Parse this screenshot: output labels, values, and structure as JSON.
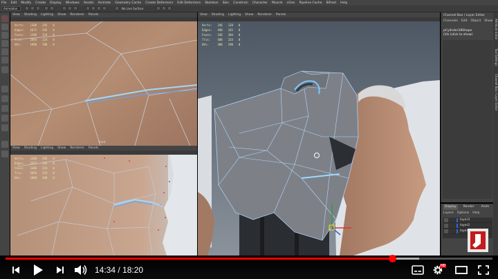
{
  "menubar": [
    "File",
    "Edit",
    "Modify",
    "Create",
    "Display",
    "Windows",
    "Assets",
    "Animate",
    "Geometry Cache",
    "Create Deformers",
    "Edit Deformers",
    "Skeleton",
    "Skin",
    "Constrain",
    "Character",
    "Muscle",
    "nGen",
    "Pipeline Cache",
    "Bifrost",
    "Help"
  ],
  "shelf": {
    "mode": "Animation",
    "live_surface": "No Live Surface"
  },
  "viewport_menu": [
    "View",
    "Shading",
    "Lighting",
    "Show",
    "Renderer",
    "Panels"
  ],
  "hud_labels": [
    "Verts:",
    "Edges:",
    "Faces:",
    "Tris:",
    "UVs:"
  ],
  "viewports": {
    "top_left": {
      "hud": [
        [
          "1388",
          "245",
          "0"
        ],
        [
          "2672",
          "245",
          "0"
        ],
        [
          "1286",
          "224",
          "0"
        ],
        [
          "2694",
          "224",
          "0"
        ],
        [
          "1898",
          "190",
          "0"
        ]
      ],
      "camera": "front"
    },
    "bottom_left": {
      "hud": [
        [
          "1388",
          "245",
          "0"
        ],
        [
          "2672",
          "245",
          "0"
        ],
        [
          "1286",
          "224",
          "0"
        ],
        [
          "2694",
          "224",
          "0"
        ],
        [
          "1898",
          "190",
          "0"
        ]
      ],
      "camera": ""
    },
    "main": {
      "hud": [
        [
          "246",
          "128",
          "0"
        ],
        [
          "490",
          "245",
          "0"
        ],
        [
          "246",
          "104",
          "0"
        ],
        [
          "488",
          "224",
          "0"
        ],
        [
          "308",
          "190",
          "0"
        ]
      ]
    }
  },
  "channel_box": {
    "title": "Channel Box / Layer Editor",
    "menu": [
      "Channels",
      "Edit",
      "Object",
      "Show"
    ],
    "object_name": "pCylinder18Shape",
    "object_hint": "(Vis (click to show)"
  },
  "attribute_tabs": [
    "Attribute Editor",
    "Tool Settings",
    "Channel Box / Layer Editor"
  ],
  "layer_editor": {
    "tabs": [
      "Display",
      "Render",
      "Anim"
    ],
    "menu": [
      "Layers",
      "Options",
      "Help"
    ],
    "layers": [
      "layer3",
      "layer2",
      "layer1"
    ]
  },
  "video": {
    "current_time": "14:34",
    "separator": " / ",
    "duration": "18:20",
    "progress": 0.795,
    "buffered": 0.85,
    "hd_badge": "HD",
    "accent_color": "#ff0000"
  }
}
